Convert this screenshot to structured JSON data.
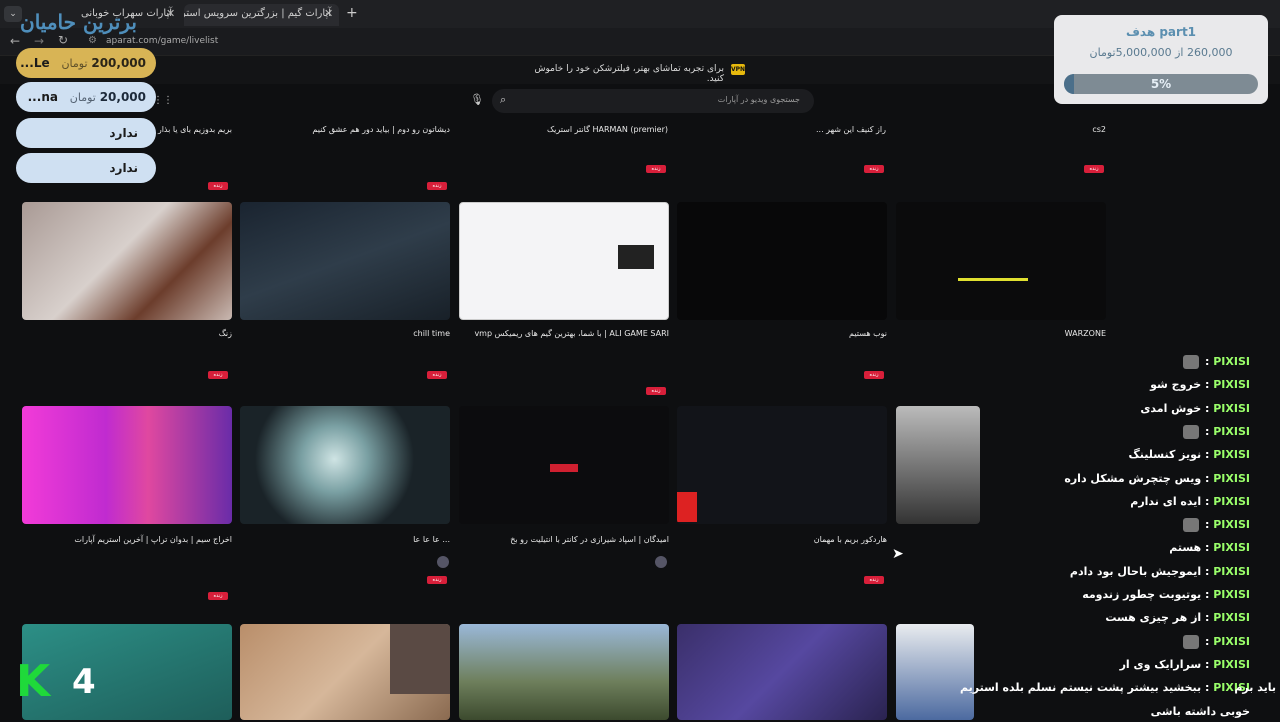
{
  "browser": {
    "tabs": [
      {
        "title": "آپارات سهراب خوبانی"
      },
      {
        "title": "آپارات گیم | بزرگترین سرویس استریم"
      }
    ],
    "url": "aparat.com/game/livelist"
  },
  "notice": {
    "vpn_label": "VPN",
    "text": "برای تجربه تماشای بهتر، فیلترشکن خود را خاموش کنید."
  },
  "search": {
    "placeholder": "جستجوی ویدیو در آپارات"
  },
  "live_badge": "زنده",
  "cards": [
    {
      "title": "بریم بدوزیم بای یا بذار ..."
    },
    {
      "title": "دیشاتون رو دوم | بیاید دور هم عشق کنیم"
    },
    {
      "title": "HARMAN (premier) گانتر استریک"
    },
    {
      "title": "راز کنیف این شهر ..."
    },
    {
      "title": "cs2"
    },
    {
      "title": "زنگ"
    },
    {
      "title": "chill time"
    },
    {
      "title": "ALI GAME SARI | با شما، بهترین گیم های ریمیکس vmp"
    },
    {
      "title": "نوب هستیم"
    },
    {
      "title": "WARZONE"
    },
    {
      "title": "اخراج سیم | بدوان تراپ | آخرین استریم آپارات"
    },
    {
      "title": "... عا عا عا"
    },
    {
      "title": "امیدگان | اسپاد شیرازی در کانتر با انتیلیت رو بخ"
    },
    {
      "title": "هاردکور بریم با مهمان"
    }
  ],
  "donors": [
    {
      "amount": "200,000",
      "currency": "تومان",
      "name": "Le..."
    },
    {
      "amount": "20,000",
      "currency": "تومان",
      "name": "na..."
    },
    {
      "amount": "",
      "currency": "",
      "name": "ندارد"
    },
    {
      "amount": "",
      "currency": "",
      "name": "ندارد"
    }
  ],
  "overlay_logo": "برترین حامیان",
  "goal": {
    "title": "هدف part1",
    "progress": "260,000 از 5,000,000تومان",
    "percent_label": "5%",
    "fraction": 0.052
  },
  "chat": [
    {
      "user": "PIXISI",
      "msg": ""
    },
    {
      "user": "PIXISI",
      "msg": "خروج شو"
    },
    {
      "user": "PIXISI",
      "msg": "خوش امدی"
    },
    {
      "user": "PIXISI",
      "msg": ""
    },
    {
      "user": "PIXISI",
      "msg": "نویز کنسلینگ"
    },
    {
      "user": "PIXISI",
      "msg": "ویس چتچرش مشکل داره"
    },
    {
      "user": "PIXISI",
      "msg": "ایده ای ندارم"
    },
    {
      "user": "PIXISI",
      "msg": ""
    },
    {
      "user": "PIXISI",
      "msg": "هستم"
    },
    {
      "user": "PIXISI",
      "msg": "ایموجیش باحال بود دادم"
    },
    {
      "user": "PIXISI",
      "msg": "یوتیوبت چطور زندومه"
    },
    {
      "user": "PIXISI",
      "msg": "از هر چیزی هست"
    },
    {
      "user": "PIXISI",
      "msg": ""
    },
    {
      "user": "PIXISI",
      "msg": "سرارایک وی ار"
    },
    {
      "user": "PIXISI",
      "msg": "ببخشید بیشتر پشت نیستم نسلم بلده استریم"
    },
    {
      "user": "",
      "msg": "خوبی داشته باشی"
    }
  ],
  "chat_tail": "باید برم",
  "kills": {
    "letter": "K",
    "count": "4"
  }
}
